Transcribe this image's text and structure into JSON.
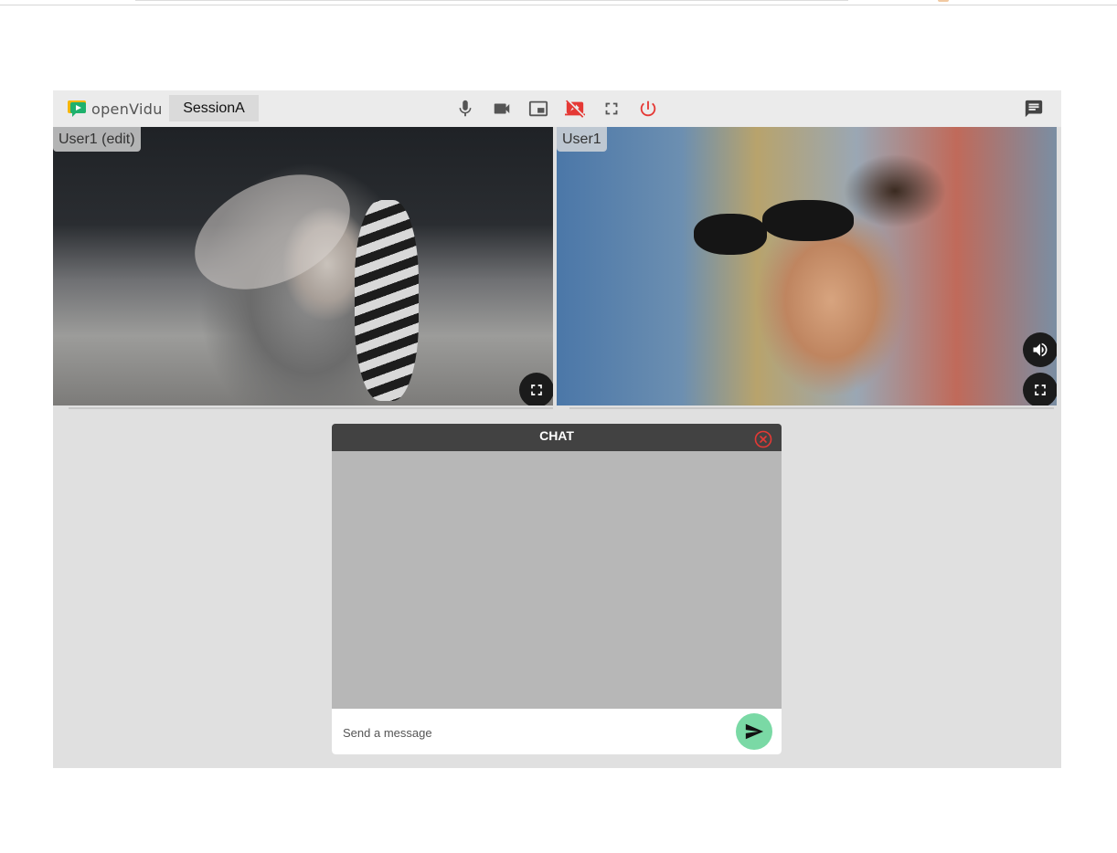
{
  "toolbar": {
    "logo_text": "openVidu",
    "session_name": "SessionA",
    "buttons": {
      "microphone": "mic-icon",
      "camera": "videocam-icon",
      "screen_share": "picture-in-picture-icon",
      "stop_screen_share": "stop-screen-share-icon",
      "fullscreen": "fullscreen-icon",
      "leave_session": "power-icon",
      "chat": "chat-icon"
    }
  },
  "videos": [
    {
      "nickname": "User1 (edit)",
      "controls": [
        "fullscreen-icon"
      ]
    },
    {
      "nickname": "User1",
      "controls": [
        "volume-icon",
        "fullscreen-icon"
      ]
    }
  ],
  "chat": {
    "title": "CHAT",
    "input_placeholder": "Send a message",
    "input_value": ""
  },
  "colors": {
    "accent_red": "#e53935",
    "send_button": "#7ad9a5",
    "chat_header": "#424242",
    "session_background": "#e0e0e0"
  }
}
